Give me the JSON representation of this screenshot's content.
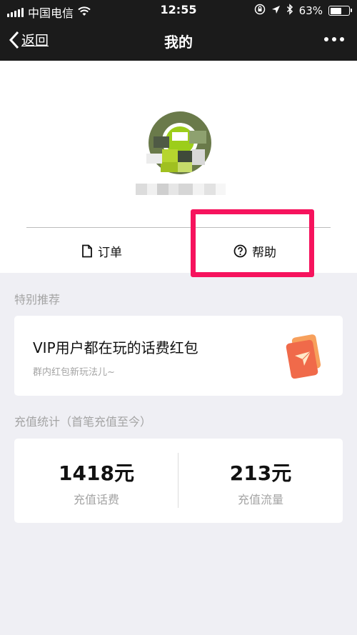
{
  "status_bar": {
    "carrier": "中国电信",
    "time": "12:55",
    "battery": "63%",
    "battery_level": 0.63,
    "icons": [
      "signal-icon",
      "wifi-icon",
      "lock-rotation-icon",
      "location-icon",
      "bluetooth-icon",
      "battery-icon"
    ]
  },
  "nav": {
    "back_label": "返回",
    "title": "我的",
    "more_icon": "more-dots-icon"
  },
  "tabs": {
    "order_label": "订单",
    "order_icon": "document-icon",
    "help_label": "帮助",
    "help_icon": "question-circle-icon"
  },
  "special": {
    "section_title": "特别推荐",
    "card_title": "VIP用户都在玩的话费红包",
    "card_subtitle": "群内红包新玩法儿~",
    "card_icon": "red-envelope-icon"
  },
  "stats": {
    "section_title": "充值统计（首笔充值至今）",
    "fee_value": "1418元",
    "fee_label": "充值话费",
    "data_value": "213元",
    "data_label": "充值流量"
  },
  "colors": {
    "nav_bg": "#1b1b1b",
    "page_bg": "#efeff4",
    "highlight": "#f6135d",
    "muted_text": "#a4a4a4",
    "envelope": "#f06a4a"
  }
}
